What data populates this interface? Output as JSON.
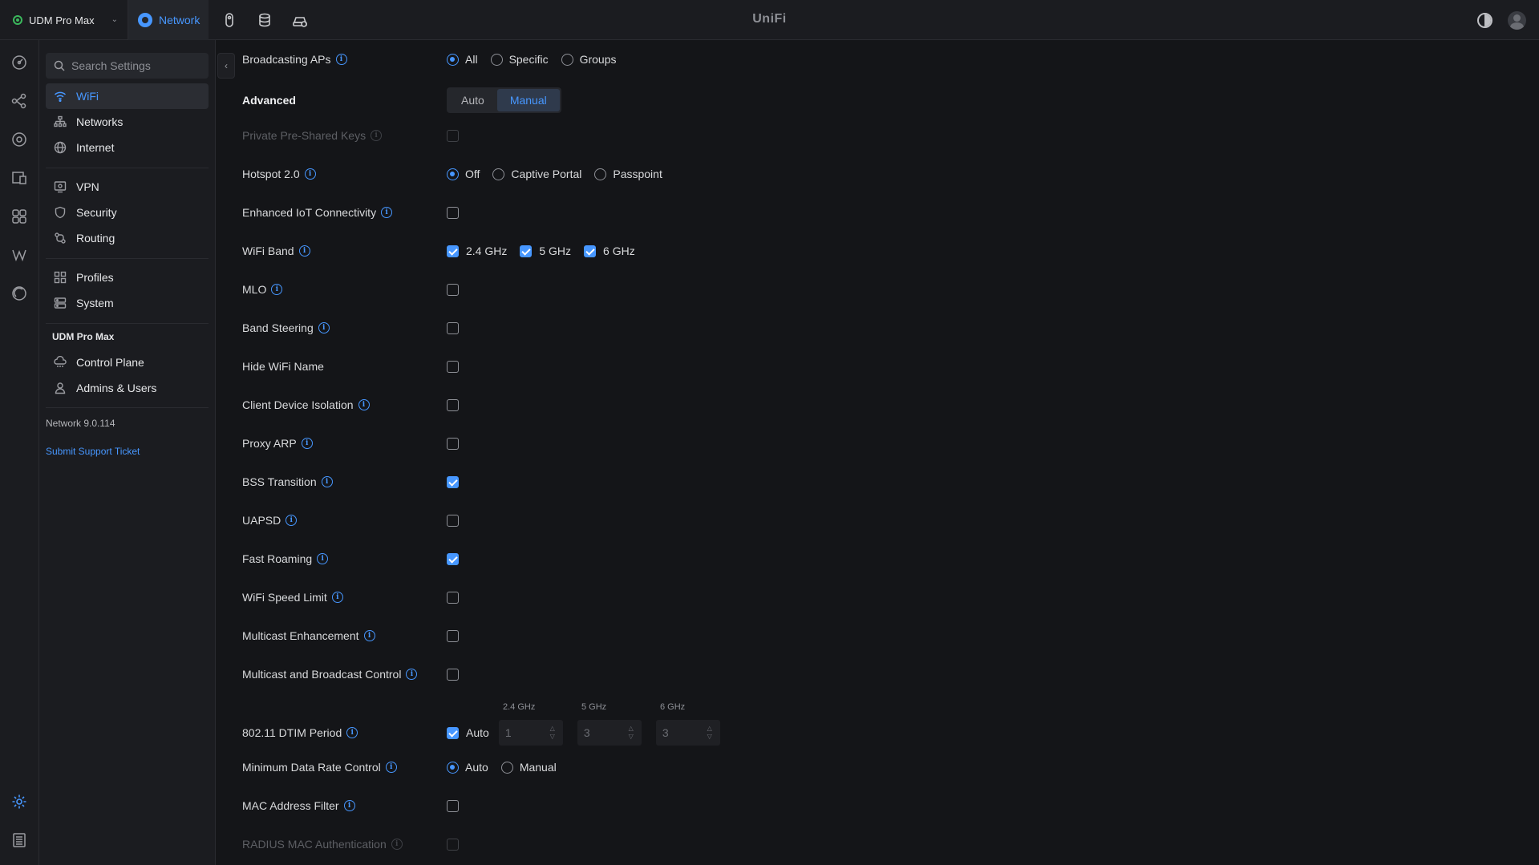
{
  "topbar": {
    "device": "UDM Pro Max",
    "app_tab": "Network",
    "brand": "UniFi"
  },
  "settings_nav": {
    "search_placeholder": "Search Settings",
    "group1": [
      {
        "label": "WiFi",
        "icon": "wifi-icon",
        "active": true
      },
      {
        "label": "Networks",
        "icon": "networks-icon"
      },
      {
        "label": "Internet",
        "icon": "globe-icon"
      }
    ],
    "group2": [
      {
        "label": "VPN",
        "icon": "vpn-icon"
      },
      {
        "label": "Security",
        "icon": "shield-icon"
      },
      {
        "label": "Routing",
        "icon": "routing-icon"
      }
    ],
    "group3": [
      {
        "label": "Profiles",
        "icon": "profiles-icon"
      },
      {
        "label": "System",
        "icon": "system-icon"
      }
    ],
    "device_section": "UDM Pro Max",
    "group4": [
      {
        "label": "Control Plane",
        "icon": "control-plane-icon"
      },
      {
        "label": "Admins & Users",
        "icon": "users-icon"
      }
    ],
    "version": "Network 9.0.114",
    "support_link": "Submit Support Ticket"
  },
  "form": {
    "broadcasting_aps": {
      "label": "Broadcasting APs",
      "options": [
        "All",
        "Specific",
        "Groups"
      ],
      "selected": "All"
    },
    "advanced": {
      "label": "Advanced",
      "options": [
        "Auto",
        "Manual"
      ],
      "selected": "Manual"
    },
    "ppsk": {
      "label": "Private Pre-Shared Keys",
      "checked": false,
      "disabled": true
    },
    "hotspot": {
      "label": "Hotspot 2.0",
      "options": [
        "Off",
        "Captive Portal",
        "Passpoint"
      ],
      "selected": "Off"
    },
    "iot": {
      "label": "Enhanced IoT Connectivity",
      "checked": false
    },
    "wifi_band": {
      "label": "WiFi Band",
      "bands": [
        {
          "label": "2.4 GHz",
          "checked": true
        },
        {
          "label": "5 GHz",
          "checked": true
        },
        {
          "label": "6 GHz",
          "checked": true
        }
      ]
    },
    "mlo": {
      "label": "MLO",
      "checked": false
    },
    "band_steering": {
      "label": "Band Steering",
      "checked": false
    },
    "hide_name": {
      "label": "Hide WiFi Name",
      "checked": false
    },
    "client_isolation": {
      "label": "Client Device Isolation",
      "checked": false
    },
    "proxy_arp": {
      "label": "Proxy ARP",
      "checked": false
    },
    "bss_transition": {
      "label": "BSS Transition",
      "checked": true
    },
    "uapsd": {
      "label": "UAPSD",
      "checked": false
    },
    "fast_roaming": {
      "label": "Fast Roaming",
      "checked": true
    },
    "speed_limit": {
      "label": "WiFi Speed Limit",
      "checked": false
    },
    "multicast_enh": {
      "label": "Multicast Enhancement",
      "checked": false
    },
    "multicast_ctrl": {
      "label": "Multicast and Broadcast Control",
      "checked": false
    },
    "dtim": {
      "label": "802.11 DTIM Period",
      "auto_label": "Auto",
      "auto_checked": true,
      "columns": [
        {
          "band": "2.4 GHz",
          "value": "1"
        },
        {
          "band": "5 GHz",
          "value": "3"
        },
        {
          "band": "6 GHz",
          "value": "3"
        }
      ]
    },
    "min_rate": {
      "label": "Minimum Data Rate Control",
      "options": [
        "Auto",
        "Manual"
      ],
      "selected": "Auto"
    },
    "mac_filter": {
      "label": "MAC Address Filter",
      "checked": false
    },
    "radius_mac": {
      "label": "RADIUS MAC Authentication",
      "checked": false,
      "disabled": true
    }
  },
  "colors": {
    "accent": "#4797ff",
    "background": "#141518",
    "panel": "#1b1c20"
  }
}
